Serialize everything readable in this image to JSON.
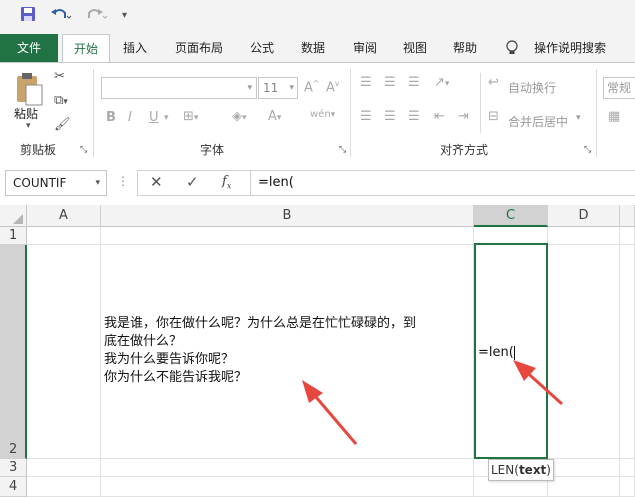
{
  "quick_access": {
    "save_icon": "save-icon",
    "undo_icon": "undo-icon",
    "redo_icon": "redo-icon",
    "customize_icon": "customize-icon"
  },
  "tabs": [
    {
      "label": "文件"
    },
    {
      "label": "开始"
    },
    {
      "label": "插入"
    },
    {
      "label": "页面布局"
    },
    {
      "label": "公式"
    },
    {
      "label": "数据"
    },
    {
      "label": "审阅"
    },
    {
      "label": "视图"
    },
    {
      "label": "帮助"
    },
    {
      "label": "操作说明搜索"
    }
  ],
  "ribbon": {
    "clipboard": {
      "paste_label": "粘贴",
      "group_label": "剪贴板"
    },
    "font": {
      "font_size": "11",
      "group_label": "字体",
      "bold": "B",
      "italic": "I",
      "underline": "U"
    },
    "alignment": {
      "wrap_text": "自动换行",
      "merge_center": "合并后居中",
      "group_label": "对齐方式"
    },
    "number": {
      "format": "常规"
    }
  },
  "formula_bar": {
    "name_box": "COUNTIF",
    "formula": "=len("
  },
  "columns": [
    "A",
    "B",
    "C",
    "D"
  ],
  "rows": [
    "1",
    "2",
    "3",
    "4"
  ],
  "cells": {
    "B2": "我是谁，你在做什么呢？为什么总是在忙忙碌碌的，到\n底在做什么？\n我为什么要告诉你呢？\n你为什么不能告诉我呢？",
    "C2": "=len("
  },
  "tooltip": {
    "prefix": "LEN(",
    "arg": "text",
    "suffix": ")"
  },
  "colors": {
    "accent": "#217346",
    "arrow": "#e8473f"
  }
}
